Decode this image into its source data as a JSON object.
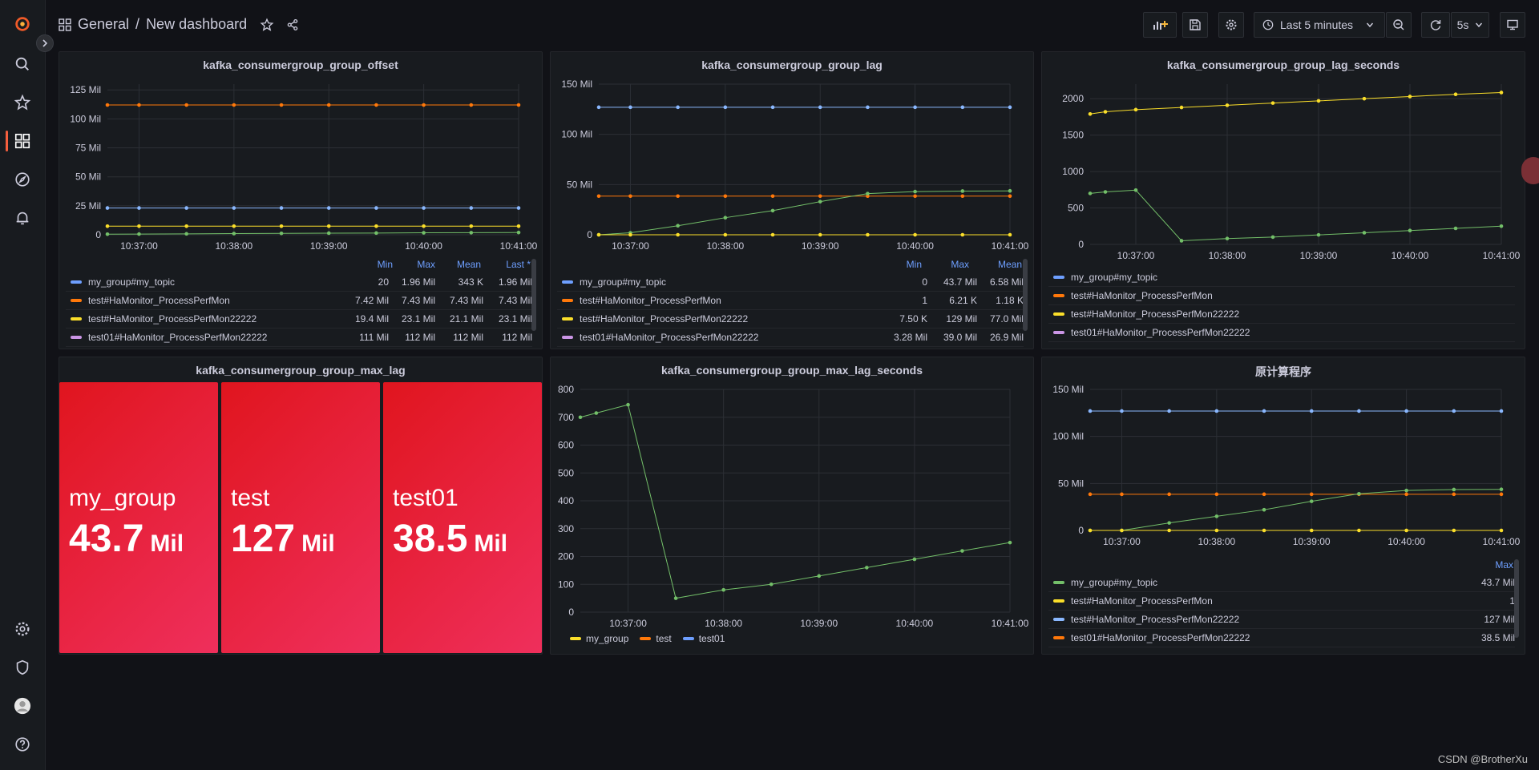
{
  "breadcrumb": {
    "folder": "General",
    "separator": "/",
    "title": "New dashboard"
  },
  "toolbar": {
    "time_range": "Last 5 minutes",
    "refresh_interval": "5s"
  },
  "colors": {
    "green": "#73bf69",
    "yellow": "#fade2a",
    "blue": "#8ab8ff",
    "orange": "#ff780a",
    "lightorange": "#ffb357",
    "purple": "#ca95e5",
    "stat_red": "#e0151e"
  },
  "panels": {
    "offset": {
      "title": "kafka_consumergroup_group_offset",
      "legend_headers": [
        "Min",
        "Max",
        "Mean",
        "Last *"
      ],
      "legend": [
        {
          "name": "my_group#my_topic",
          "color": "#6e9fff",
          "values": [
            "20",
            "1.96 Mil",
            "343 K",
            "1.96 Mil"
          ]
        },
        {
          "name": "test#HaMonitor_ProcessPerfMon",
          "color": "#ff780a",
          "values": [
            "7.42 Mil",
            "7.43 Mil",
            "7.43 Mil",
            "7.43 Mil"
          ]
        },
        {
          "name": "test#HaMonitor_ProcessPerfMon22222",
          "color": "#fade2a",
          "values": [
            "19.4 Mil",
            "23.1 Mil",
            "21.1 Mil",
            "23.1 Mil"
          ]
        },
        {
          "name": "test01#HaMonitor_ProcessPerfMon22222",
          "color": "#ca95e5",
          "values": [
            "111 Mil",
            "112 Mil",
            "112 Mil",
            "112 Mil"
          ]
        }
      ]
    },
    "lag": {
      "title": "kafka_consumergroup_group_lag",
      "legend_headers": [
        "Min",
        "Max",
        "Mean"
      ],
      "legend": [
        {
          "name": "my_group#my_topic",
          "color": "#6e9fff",
          "values": [
            "0",
            "43.7 Mil",
            "6.58 Mil"
          ]
        },
        {
          "name": "test#HaMonitor_ProcessPerfMon",
          "color": "#ff780a",
          "values": [
            "1",
            "6.21 K",
            "1.18 K"
          ]
        },
        {
          "name": "test#HaMonitor_ProcessPerfMon22222",
          "color": "#fade2a",
          "values": [
            "7.50 K",
            "129 Mil",
            "77.0 Mil"
          ]
        },
        {
          "name": "test01#HaMonitor_ProcessPerfMon22222",
          "color": "#ca95e5",
          "values": [
            "3.28 Mil",
            "39.0 Mil",
            "26.9 Mil"
          ]
        }
      ]
    },
    "lag_seconds": {
      "title": "kafka_consumergroup_group_lag_seconds",
      "legend": [
        {
          "name": "my_group#my_topic",
          "color": "#6e9fff"
        },
        {
          "name": "test#HaMonitor_ProcessPerfMon",
          "color": "#ff780a"
        },
        {
          "name": "test#HaMonitor_ProcessPerfMon22222",
          "color": "#fade2a"
        },
        {
          "name": "test01#HaMonitor_ProcessPerfMon22222",
          "color": "#ca95e5"
        }
      ]
    },
    "max_lag": {
      "title": "kafka_consumergroup_group_max_lag",
      "stats": [
        {
          "name": "my_group",
          "value": "43.7",
          "unit": "Mil"
        },
        {
          "name": "test",
          "value": "127",
          "unit": "Mil"
        },
        {
          "name": "test01",
          "value": "38.5",
          "unit": "Mil"
        }
      ]
    },
    "max_lag_seconds": {
      "title": "kafka_consumergroup_group_max_lag_seconds",
      "legend": [
        {
          "name": "my_group",
          "color": "#fade2a"
        },
        {
          "name": "test",
          "color": "#ff780a"
        },
        {
          "name": "test01",
          "color": "#6e9fff"
        }
      ]
    },
    "calc": {
      "title": "原计算程序",
      "legend_headers": [
        "Max"
      ],
      "legend": [
        {
          "name": "my_group#my_topic",
          "color": "#73bf69",
          "values": [
            "43.7 Mil"
          ]
        },
        {
          "name": "test#HaMonitor_ProcessPerfMon",
          "color": "#fade2a",
          "values": [
            "1"
          ]
        },
        {
          "name": "test#HaMonitor_ProcessPerfMon22222",
          "color": "#8ab8ff",
          "values": [
            "127 Mil"
          ]
        },
        {
          "name": "test01#HaMonitor_ProcessPerfMon22222",
          "color": "#ff780a",
          "values": [
            "38.5 Mil"
          ]
        }
      ]
    }
  },
  "chart_data": [
    {
      "id": "offset",
      "type": "line",
      "x": [
        "10:36:40",
        "10:37:00",
        "10:37:30",
        "10:38:00",
        "10:38:30",
        "10:39:00",
        "10:39:30",
        "10:40:00",
        "10:40:30",
        "10:41:00"
      ],
      "xticks": [
        "10:37:00",
        "10:38:00",
        "10:39:00",
        "10:40:00",
        "10:41:00"
      ],
      "yticks": [
        "0",
        "25 Mil",
        "50 Mil",
        "75 Mil",
        "100 Mil",
        "125 Mil"
      ],
      "ylim": [
        0,
        130
      ],
      "series": [
        {
          "color": "#ff780a",
          "values": [
            112,
            112,
            112,
            112,
            112,
            112,
            112,
            112,
            112,
            112
          ]
        },
        {
          "color": "#8ab8ff",
          "values": [
            23.1,
            23.1,
            23.1,
            23.1,
            23.1,
            23.1,
            23.1,
            23.1,
            23.1,
            23.1
          ]
        },
        {
          "color": "#fade2a",
          "values": [
            7.4,
            7.4,
            7.4,
            7.4,
            7.4,
            7.4,
            7.4,
            7.4,
            7.4,
            7.4
          ]
        },
        {
          "color": "#73bf69",
          "values": [
            0.5,
            0.6,
            0.8,
            1.0,
            1.2,
            1.4,
            1.5,
            1.7,
            1.8,
            1.96
          ]
        }
      ]
    },
    {
      "id": "lag",
      "type": "line",
      "x": [
        "10:36:40",
        "10:37:00",
        "10:37:30",
        "10:38:00",
        "10:38:30",
        "10:39:00",
        "10:39:30",
        "10:40:00",
        "10:40:30",
        "10:41:00"
      ],
      "xticks": [
        "10:37:00",
        "10:38:00",
        "10:39:00",
        "10:40:00",
        "10:41:00"
      ],
      "yticks": [
        "0",
        "50 Mil",
        "100 Mil",
        "150 Mil"
      ],
      "ylim": [
        0,
        150
      ],
      "series": [
        {
          "color": "#8ab8ff",
          "values": [
            127,
            127,
            127,
            127,
            127,
            127,
            127,
            127,
            127,
            127
          ]
        },
        {
          "color": "#ff780a",
          "values": [
            38.5,
            38.5,
            38.5,
            38.5,
            38.5,
            38.5,
            38.5,
            38.5,
            38.5,
            38.5
          ]
        },
        {
          "color": "#73bf69",
          "values": [
            0,
            2,
            9,
            17,
            24,
            33,
            41,
            43,
            43.5,
            43.7
          ]
        },
        {
          "color": "#fade2a",
          "values": [
            0,
            0,
            0,
            0,
            0,
            0,
            0,
            0,
            0,
            0
          ]
        }
      ]
    },
    {
      "id": "lag_seconds",
      "type": "line",
      "x": [
        "10:36:30",
        "10:36:40",
        "10:37:00",
        "10:37:30",
        "10:38:00",
        "10:38:30",
        "10:39:00",
        "10:39:30",
        "10:40:00",
        "10:40:30",
        "10:41:00"
      ],
      "xticks": [
        "10:37:00",
        "10:38:00",
        "10:39:00",
        "10:40:00",
        "10:41:00"
      ],
      "yticks": [
        "0",
        "500",
        "1000",
        "1500",
        "2000"
      ],
      "ylim": [
        0,
        2200
      ],
      "series": [
        {
          "color": "#fade2a",
          "values": [
            1790,
            1820,
            1850,
            1880,
            1910,
            1940,
            1970,
            2000,
            2030,
            2060,
            2085
          ]
        },
        {
          "color": "#73bf69",
          "values": [
            700,
            720,
            745,
            50,
            80,
            100,
            130,
            160,
            190,
            220,
            250
          ]
        }
      ]
    },
    {
      "id": "max_lag_seconds",
      "type": "line",
      "x": [
        "10:36:30",
        "10:36:40",
        "10:37:00",
        "10:37:30",
        "10:38:00",
        "10:38:30",
        "10:39:00",
        "10:39:30",
        "10:40:00",
        "10:40:30",
        "10:41:00"
      ],
      "xticks": [
        "10:37:00",
        "10:38:00",
        "10:39:00",
        "10:40:00",
        "10:41:00"
      ],
      "yticks": [
        "0",
        "100",
        "200",
        "300",
        "400",
        "500",
        "600",
        "700",
        "800"
      ],
      "ylim": [
        0,
        800
      ],
      "series": [
        {
          "color": "#73bf69",
          "values": [
            700,
            715,
            745,
            50,
            80,
            100,
            130,
            160,
            190,
            220,
            250
          ]
        }
      ]
    },
    {
      "id": "calc",
      "type": "line",
      "x": [
        "10:36:40",
        "10:37:00",
        "10:37:30",
        "10:38:00",
        "10:38:30",
        "10:39:00",
        "10:39:30",
        "10:40:00",
        "10:40:30",
        "10:41:00"
      ],
      "xticks": [
        "10:37:00",
        "10:38:00",
        "10:39:00",
        "10:40:00",
        "10:41:00"
      ],
      "yticks": [
        "0",
        "50 Mil",
        "100 Mil",
        "150 Mil"
      ],
      "ylim": [
        0,
        150
      ],
      "series": [
        {
          "color": "#8ab8ff",
          "values": [
            127,
            127,
            127,
            127,
            127,
            127,
            127,
            127,
            127,
            127
          ]
        },
        {
          "color": "#ff780a",
          "values": [
            38.5,
            38.5,
            38.5,
            38.5,
            38.5,
            38.5,
            38.5,
            38.5,
            38.5,
            38.5
          ]
        },
        {
          "color": "#73bf69",
          "values": [
            0,
            0,
            8,
            15,
            22,
            31,
            39,
            42.5,
            43.5,
            43.7
          ]
        },
        {
          "color": "#fade2a",
          "values": [
            0,
            0,
            0,
            0,
            0,
            0,
            0,
            0,
            0,
            0
          ]
        }
      ]
    }
  ],
  "watermark": "CSDN @BrotherXu"
}
